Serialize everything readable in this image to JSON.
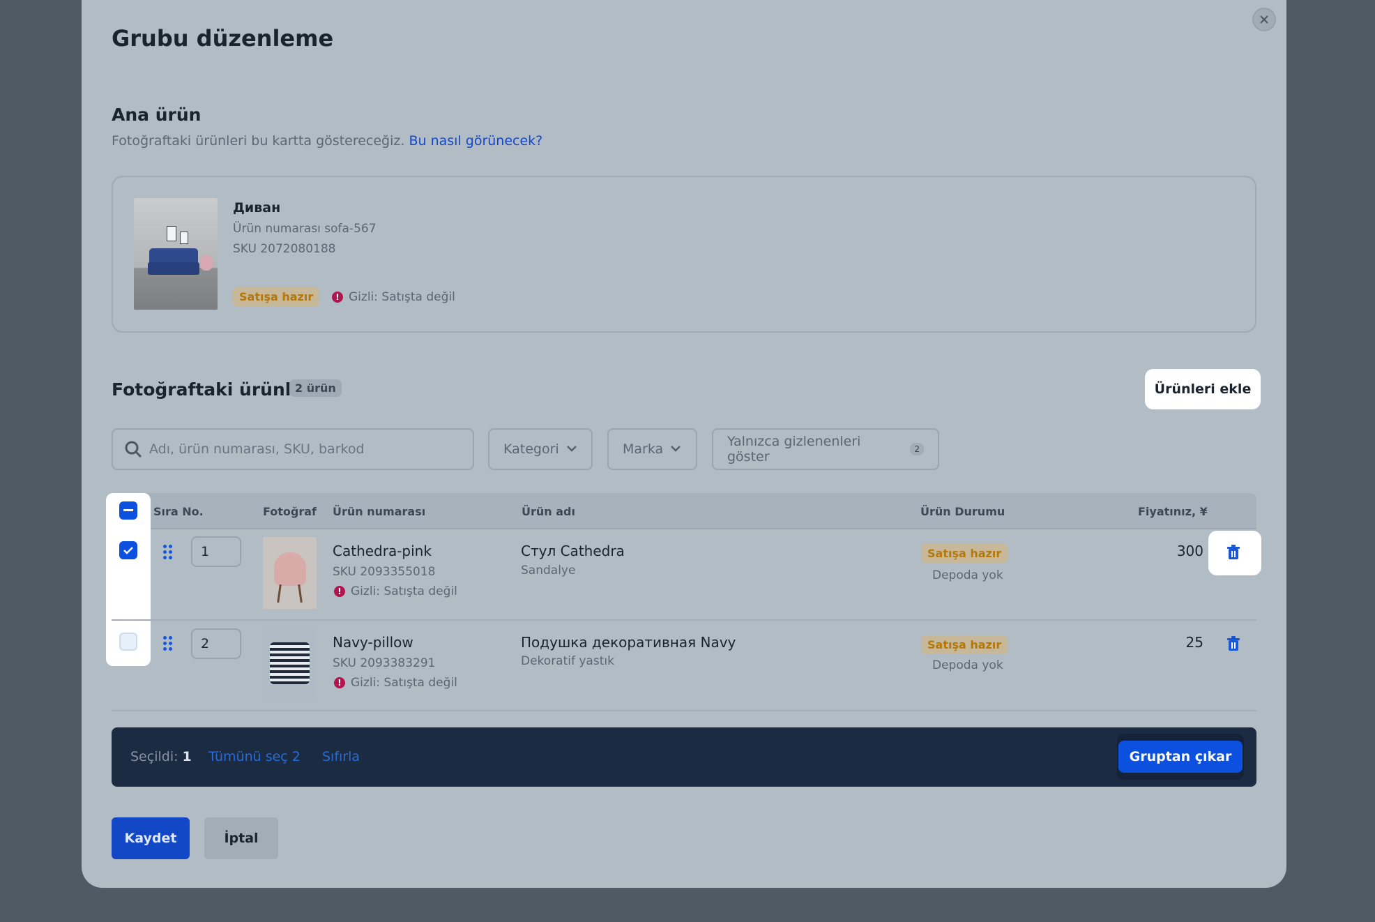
{
  "modal": {
    "title": "Grubu düzenleme",
    "close_icon": "close-icon"
  },
  "main_product": {
    "heading": "Ana ürün",
    "description": "Fotoğraftaki ürünleri bu kartta göstereceğiz.",
    "help_link": "Bu nasıl görünecek?",
    "name": "Диван",
    "article": "Ürün numarası sofa-567",
    "sku": "SKU 2072080188",
    "status": "Satışa hazır",
    "hidden_note": "Gizli: Satışta değil",
    "warn_glyph": "!"
  },
  "photo_products": {
    "heading": "Fotoğraftaki ürünler",
    "count_badge": "2 ürün",
    "add_button": "Ürünleri ekle"
  },
  "filters": {
    "search_placeholder": "Adı, ürün numarası, SKU, barkod",
    "category": "Kategori",
    "brand": "Marka",
    "hidden_only": "Yalnızca gizlenenleri göster",
    "hidden_only_count": "2"
  },
  "table": {
    "columns": {
      "order": "Sıra No.",
      "photo": "Fotoğraf",
      "article": "Ürün numarası",
      "name": "Ürün adı",
      "status": "Ürün Durumu",
      "price": "Fiyatınız, ¥"
    },
    "rows": [
      {
        "selected": true,
        "order": "1",
        "article": "Cathedra-pink",
        "sku": "SKU 2093355018",
        "hidden_note": "Gizli: Satışta değil",
        "name": "Стул Cathedra",
        "category": "Sandalye",
        "status": "Satışa hazır",
        "stock": "Depoda yok",
        "price": "300"
      },
      {
        "selected": false,
        "order": "2",
        "article": "Navy-pillow",
        "sku": "SKU 2093383291",
        "hidden_note": "Gizli: Satışta değil",
        "name": "Подушка декоративная Navy",
        "category": "Dekoratif yastık",
        "status": "Satışa hazır",
        "stock": "Depoda yok",
        "price": "25"
      }
    ]
  },
  "bulk_bar": {
    "selected_label": "Seçildi:",
    "selected_count": "1",
    "select_all": "Tümünü seç 2",
    "reset": "Sıfırla",
    "remove_button": "Gruptan çıkar"
  },
  "footer": {
    "save": "Kaydet",
    "cancel": "İptal"
  },
  "colors": {
    "accent": "#0c50e0",
    "overlay": "#505a65",
    "modal_bg": "#b2bcc5",
    "status_ready": "#b57708",
    "warn": "#b0154f",
    "bulk_bar": "#1b2b42"
  }
}
